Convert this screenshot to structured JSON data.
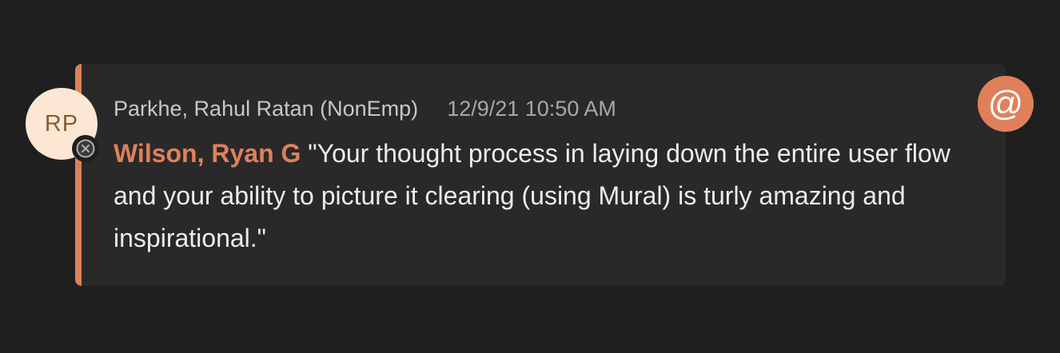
{
  "message": {
    "avatar_initials": "RP",
    "sender": "Parkhe, Rahul Ratan (NonEmp)",
    "timestamp": "12/9/21 10:50 AM",
    "mention_name": "Wilson, Ryan G",
    "text": " \"Your thought process in laying down the entire user flow and your ability to picture it clearing (using Mural) is turly amazing and inspirational.\""
  },
  "icons": {
    "presence_status": "offline-status-icon",
    "mention": "at-mention-icon"
  },
  "mention_badge_symbol": "@",
  "colors": {
    "background": "#1f1f1f",
    "card": "#292929",
    "accent": "#e0805a",
    "avatar_bg": "#fce7d4",
    "avatar_text": "#8a5a33"
  }
}
